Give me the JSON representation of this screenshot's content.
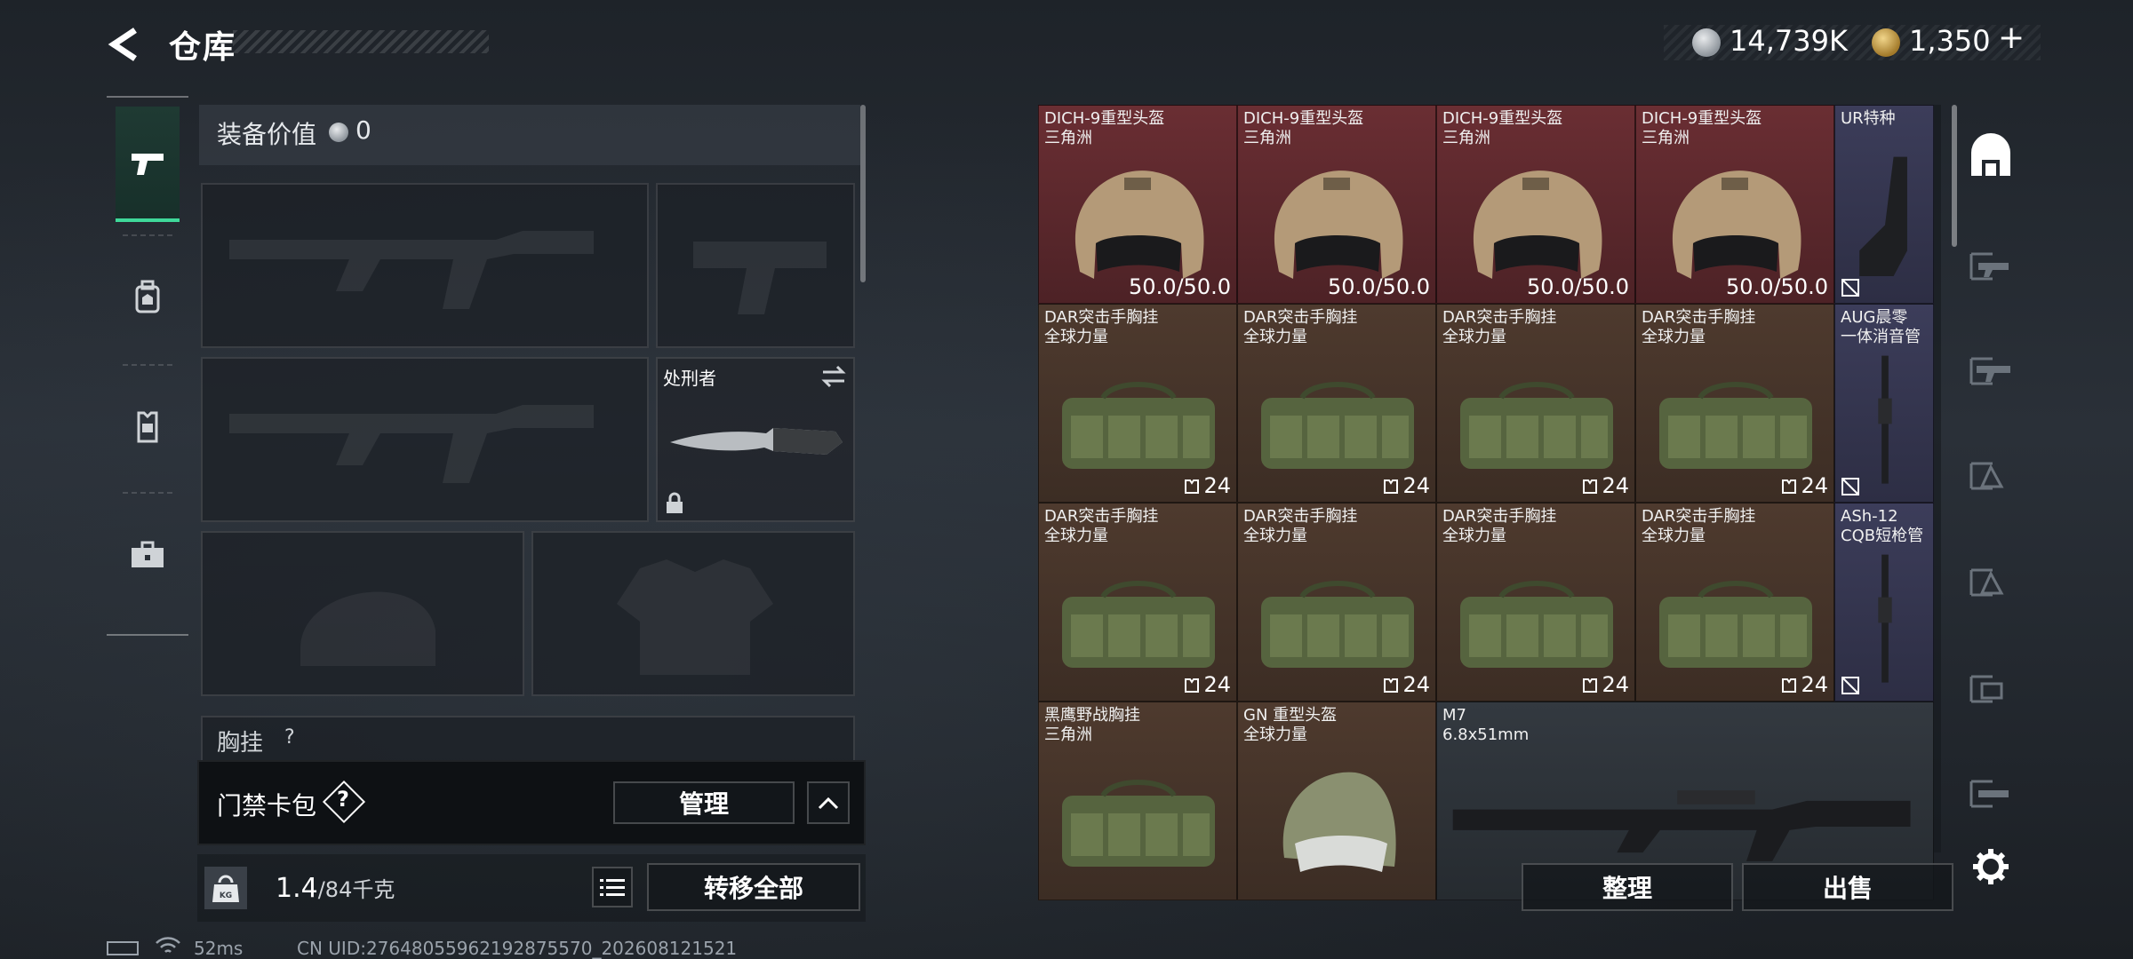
{
  "header": {
    "title": "仓库",
    "silver": "14,739K",
    "gold": "1,350",
    "gold_plus": "+"
  },
  "left_rail": {
    "tabs": [
      "weapons",
      "backpack",
      "vest",
      "case"
    ]
  },
  "equipment": {
    "value_label": "装备价值",
    "value": "0",
    "melee_label": "处刑者",
    "chest_label": "胸挂",
    "chest_question": "?"
  },
  "keycard": {
    "label": "门禁卡包",
    "help": "?",
    "manage": "管理"
  },
  "weight": {
    "current": "1.4",
    "max": "/84千克",
    "kg_tag": "KG",
    "transfer_all": "转移全部"
  },
  "inventory": {
    "cells": [
      {
        "name": "DICH-9重型头盔\n三角洲",
        "value": "50.0/50.0",
        "color": "red",
        "kind": "helmet"
      },
      {
        "name": "DICH-9重型头盔\n三角洲",
        "value": "50.0/50.0",
        "color": "red",
        "kind": "helmet"
      },
      {
        "name": "DICH-9重型头盔\n三角洲",
        "value": "50.0/50.0",
        "color": "red",
        "kind": "helmet"
      },
      {
        "name": "DICH-9重型头盔\n三角洲",
        "value": "50.0/50.0",
        "color": "red",
        "kind": "helmet"
      },
      {
        "name": "UR特种",
        "value": "",
        "color": "purple",
        "kind": "stock"
      },
      {
        "name": "DAR突击手胸挂\n全球力量",
        "value": "24",
        "color": "brown",
        "kind": "rig"
      },
      {
        "name": "DAR突击手胸挂\n全球力量",
        "value": "24",
        "color": "brown",
        "kind": "rig"
      },
      {
        "name": "DAR突击手胸挂\n全球力量",
        "value": "24",
        "color": "brown",
        "kind": "rig"
      },
      {
        "name": "DAR突击手胸挂\n全球力量",
        "value": "24",
        "color": "brown",
        "kind": "rig"
      },
      {
        "name": "AUG晨零\n一体消音管",
        "value": "",
        "color": "purple",
        "kind": "barrel"
      },
      {
        "name": "DAR突击手胸挂\n全球力量",
        "value": "24",
        "color": "brown",
        "kind": "rig"
      },
      {
        "name": "DAR突击手胸挂\n全球力量",
        "value": "24",
        "color": "brown",
        "kind": "rig"
      },
      {
        "name": "DAR突击手胸挂\n全球力量",
        "value": "24",
        "color": "brown",
        "kind": "rig"
      },
      {
        "name": "DAR突击手胸挂\n全球力量",
        "value": "24",
        "color": "brown",
        "kind": "rig"
      },
      {
        "name": "ASh-12\nCQB短枪管",
        "value": "",
        "color": "purple",
        "kind": "barrel"
      },
      {
        "name": "黑鹰野战胸挂\n三角洲",
        "value": "",
        "color": "brown",
        "kind": "rig"
      },
      {
        "name": "GN 重型头盔\n全球力量",
        "value": "",
        "color": "brown",
        "kind": "helmet2"
      },
      {
        "name": "M7\n6.8x51mm",
        "value": "",
        "color": "grey",
        "kind": "rifle"
      }
    ]
  },
  "actions": {
    "sort": "整理",
    "sell": "出售"
  },
  "status": {
    "ping": "52ms",
    "uid": "CN UID:27648055962192875570_202608121521"
  },
  "colors": {
    "accent_green": "#3fd99a",
    "cell_red": "#6a2e33",
    "cell_brown": "#4e3a2e",
    "cell_purple": "#3c3d5a"
  }
}
